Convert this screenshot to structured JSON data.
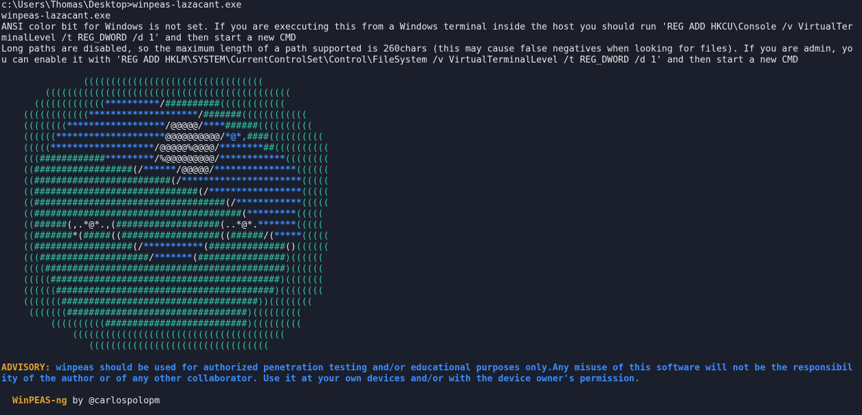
{
  "terminal": {
    "prompt_line": "c:\\Users\\Thomas\\Desktop>winpeas-lazacant.exe",
    "echo_line": "winpeas-lazacant.exe",
    "ansi_line_1": "ANSI color bit for Windows is not set. If you are execcuting this from a Windows terminal inside the host you should run 'REG ADD HKCU\\Console /v VirtualTer",
    "ansi_line_2": "minalLevel /t REG_DWORD /d 1' and then start a new CMD",
    "paths_line_1": "Long paths are disabled, so the maximum length of a path supported is 260chars (this may cause false negatives when looking for files). If you are admin, yo",
    "paths_line_2": "u can enable it with 'REG ADD HKLM\\SYSTEM\\CurrentControlSet\\Control\\FileSystem /v VirtualTerminalLevel /t REG_DWORD /d 1' and then start a new CMD"
  },
  "ascii_art": [
    [
      [
        "t",
        "               ((((((((((((((((((((((((((((((((("
      ]
    ],
    [
      [
        "t",
        "        ((((((((((((((((((((((((((((((((((((((((((((("
      ]
    ],
    [
      [
        "t",
        "      ((((((((((((("
      ],
      [
        "b",
        "**********"
      ],
      [
        "w",
        "/"
      ],
      [
        "t",
        "##########(((((((((((("
      ]
    ],
    [
      [
        "t",
        "    (((((((((((("
      ],
      [
        "b",
        "********************"
      ],
      [
        "w",
        "/"
      ],
      [
        "t",
        "#######(((((((((((("
      ]
    ],
    [
      [
        "t",
        "    (((((((("
      ],
      [
        "b",
        "******************"
      ],
      [
        "w",
        "/@@@@@/"
      ],
      [
        "b",
        "****"
      ],
      [
        "t",
        "######(((((((((("
      ]
    ],
    [
      [
        "t",
        "    (((((("
      ],
      [
        "b",
        "********************"
      ],
      [
        "w",
        "@@@@@@@@@@/"
      ],
      [
        "b",
        "*@*,"
      ],
      [
        "t",
        "####(((((((((("
      ]
    ],
    [
      [
        "t",
        "    ((((("
      ],
      [
        "b",
        "*******************"
      ],
      [
        "w",
        "/@@@@@%@@@@/"
      ],
      [
        "b",
        "********"
      ],
      [
        "t",
        "##(((((((((("
      ]
    ],
    [
      [
        "t",
        "    ((("
      ],
      [
        "t",
        "############"
      ],
      [
        "b",
        "*********"
      ],
      [
        "w",
        "/%@@@@@@@@@/"
      ],
      [
        "b",
        "************"
      ],
      [
        "t",
        "(((((((("
      ]
    ],
    [
      [
        "t",
        "    (("
      ],
      [
        "t",
        "##################"
      ],
      [
        "w",
        "(/"
      ],
      [
        "b",
        "******"
      ],
      [
        "w",
        "/@@@@@/"
      ],
      [
        "b",
        "***************"
      ],
      [
        "t",
        "(((((("
      ]
    ],
    [
      [
        "t",
        "    (("
      ],
      [
        "t",
        "#########################"
      ],
      [
        "w",
        "(/"
      ],
      [
        "b",
        "**********************"
      ],
      [
        "t",
        "((((("
      ]
    ],
    [
      [
        "t",
        "    (("
      ],
      [
        "t",
        "##############################"
      ],
      [
        "w",
        "(/"
      ],
      [
        "b",
        "*****************"
      ],
      [
        "t",
        "((((("
      ]
    ],
    [
      [
        "t",
        "    (("
      ],
      [
        "t",
        "###################################"
      ],
      [
        "w",
        "(/"
      ],
      [
        "b",
        "************"
      ],
      [
        "t",
        "((((("
      ]
    ],
    [
      [
        "t",
        "    (("
      ],
      [
        "t",
        "######################################"
      ],
      [
        "w",
        "("
      ],
      [
        "b",
        "*********"
      ],
      [
        "t",
        "((((("
      ]
    ],
    [
      [
        "t",
        "    (("
      ],
      [
        "t",
        "######"
      ],
      [
        "w",
        "(,.*@*.,("
      ],
      [
        "t",
        "###################"
      ],
      [
        "w",
        "(..*@*."
      ],
      [
        "b",
        "*******"
      ],
      [
        "t",
        "((((("
      ]
    ],
    [
      [
        "t",
        "    (("
      ],
      [
        "t",
        "#######"
      ],
      [
        "w",
        "*("
      ],
      [
        "t",
        "#####"
      ],
      [
        "w",
        "(("
      ],
      [
        "t",
        "##################"
      ],
      [
        "w",
        "(("
      ],
      [
        "t",
        "######"
      ],
      [
        "w",
        "/("
      ],
      [
        "b",
        "*****"
      ],
      [
        "t",
        "((((("
      ]
    ],
    [
      [
        "t",
        "    (("
      ],
      [
        "t",
        "##################"
      ],
      [
        "w",
        "(/"
      ],
      [
        "b",
        "***********"
      ],
      [
        "w",
        "("
      ],
      [
        "t",
        "##############"
      ],
      [
        "w",
        "()"
      ],
      [
        "t",
        "(((((("
      ]
    ],
    [
      [
        "t",
        "    ((("
      ],
      [
        "t",
        "####################"
      ],
      [
        "w",
        "/"
      ],
      [
        "b",
        "*******"
      ],
      [
        "w",
        "("
      ],
      [
        "t",
        "################"
      ],
      [
        "t",
        ")(((((("
      ]
    ],
    [
      [
        "t",
        "    (((("
      ],
      [
        "t",
        "############################################"
      ],
      [
        "t",
        ")(((((("
      ]
    ],
    [
      [
        "t",
        "    ((((("
      ],
      [
        "t",
        "##########################################"
      ],
      [
        "t",
        ")((((((("
      ]
    ],
    [
      [
        "t",
        "    (((((("
      ],
      [
        "t",
        "########################################"
      ],
      [
        "t",
        ")(((((((("
      ]
    ],
    [
      [
        "t",
        "    ((((((("
      ],
      [
        "t",
        "####################################"
      ],
      [
        "t",
        "))(((((((("
      ]
    ],
    [
      [
        "t",
        "     ((((((("
      ],
      [
        "t",
        "#################################"
      ],
      [
        "t",
        ")((((((((("
      ]
    ],
    [
      [
        "t",
        "         (((((((((("
      ],
      [
        "t",
        "##########################"
      ],
      [
        "t",
        ")((((((((("
      ]
    ],
    [
      [
        "t",
        "             ((((((((((((((((((((((((((((((((((((((("
      ]
    ],
    [
      [
        "t",
        "                ((((((((((((((((((((((((((((((((("
      ]
    ]
  ],
  "advisory": {
    "label": "ADVISORY:",
    "text_1": " winpeas should be used for authorized penetration testing and/or educational purposes only.Any misuse of this software will not be the responsibil",
    "text_2": "ity of the author or of any other collaborator. Use it at your own devices and/or with the device owner's permission."
  },
  "credit": {
    "name": "WinPEAS-ng",
    "by": " by ",
    "handle": "@carlospolopm"
  },
  "colors": {
    "background": "#1b1f2b",
    "text": "#e6e6e6",
    "teal": "#35c4a4",
    "blue": "#3a8cff",
    "orange": "#e0a030"
  }
}
